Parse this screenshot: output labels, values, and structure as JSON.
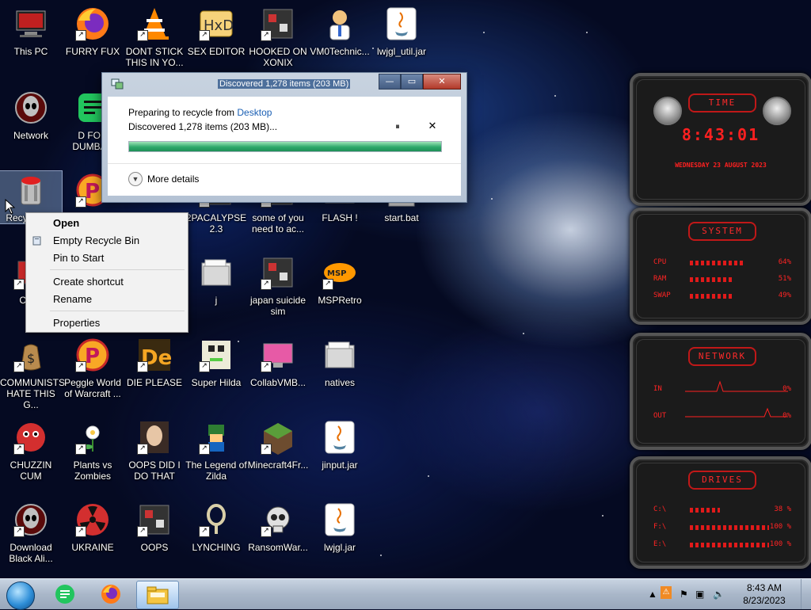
{
  "desktop_icons": [
    {
      "id": "this-pc",
      "label": "This PC",
      "icon": "computer-icon",
      "col": 0,
      "row": 0
    },
    {
      "id": "furry-fux",
      "label": "FURRY FUX",
      "icon": "firefox-icon",
      "col": 1,
      "row": 0
    },
    {
      "id": "dont-stick",
      "label": "DONT STICK THIS IN YO...",
      "icon": "vlc-cone-icon",
      "col": 2,
      "row": 0
    },
    {
      "id": "sex-editor",
      "label": "SEX EDITOR",
      "icon": "hxd-editor-icon",
      "col": 3,
      "row": 0
    },
    {
      "id": "hooked-on-xonix",
      "label": "HOOKED ON XONIX",
      "icon": "game-icon",
      "col": 4,
      "row": 0
    },
    {
      "id": "vm0technic",
      "label": "VM0Technic...",
      "icon": "doctor-icon",
      "col": 5,
      "row": 0
    },
    {
      "id": "lwjgl-util",
      "label": "lwjgl_util.jar",
      "icon": "java-jar-icon",
      "col": 6,
      "row": 0
    },
    {
      "id": "network",
      "label": "Network",
      "icon": "alien-network-icon",
      "col": 0,
      "row": 1
    },
    {
      "id": "d-for-dumbass",
      "label": "D FOR DUMBAS",
      "icon": "green-chat-icon",
      "col": 1,
      "row": 1
    },
    {
      "id": "recycle-bin",
      "label": "Recycle Bin",
      "icon": "recycle-bin-icon",
      "col": 0,
      "row": 2
    },
    {
      "id": "peggle-2",
      "label": "",
      "icon": "peggle-icon",
      "col": 1,
      "row": 2
    },
    {
      "id": "2pacalypse",
      "label": "2PACALYPSE 2.3",
      "icon": "game-icon",
      "col": 3,
      "row": 2
    },
    {
      "id": "some-of-you",
      "label": "some of you need to ac...",
      "icon": "game-icon",
      "col": 4,
      "row": 2
    },
    {
      "id": "flash",
      "label": "FLASH !",
      "icon": "folder-icon",
      "col": 5,
      "row": 2
    },
    {
      "id": "start-bat",
      "label": "start.bat",
      "icon": "batch-file-icon",
      "col": 6,
      "row": 2
    },
    {
      "id": "control-panel",
      "label": "Contr",
      "icon": "control-panel-icon",
      "col": 0,
      "row": 3
    },
    {
      "id": "j-folder",
      "label": "j",
      "icon": "folder-icon",
      "col": 3,
      "row": 3
    },
    {
      "id": "japan-suicide-sim",
      "label": "japan suicide sim",
      "icon": "game-icon",
      "col": 4,
      "row": 3
    },
    {
      "id": "msp-retro",
      "label": "MSPRetro",
      "icon": "msp-icon",
      "col": 5,
      "row": 3
    },
    {
      "id": "communists",
      "label": "COMMUNISTS HATE THIS G...",
      "icon": "money-bag-icon",
      "col": 0,
      "row": 4
    },
    {
      "id": "peggle-world",
      "label": "Peggle World of Warcraft ...",
      "icon": "peggle-icon",
      "col": 1,
      "row": 4
    },
    {
      "id": "die-please",
      "label": "DIE PLEASE",
      "icon": "de-icon",
      "col": 2,
      "row": 4
    },
    {
      "id": "super-hilda",
      "label": "Super Hilda",
      "icon": "pixel-game-icon",
      "col": 3,
      "row": 4
    },
    {
      "id": "collabvmb",
      "label": "CollabVMB...",
      "icon": "monitor-icon",
      "col": 4,
      "row": 4
    },
    {
      "id": "natives",
      "label": "natives",
      "icon": "folder-icon",
      "col": 5,
      "row": 4
    },
    {
      "id": "chuzzin-cum",
      "label": "CHUZZIN CUM",
      "icon": "chuzzle-icon",
      "col": 0,
      "row": 5
    },
    {
      "id": "plants-vs-zombies",
      "label": "Plants vs Zombies",
      "icon": "flower-icon",
      "col": 1,
      "row": 5
    },
    {
      "id": "oops-did-i",
      "label": "OOPS DID I DO THAT",
      "icon": "portrait-icon",
      "col": 2,
      "row": 5
    },
    {
      "id": "legend-of-zilda",
      "label": "The Legend of Zilda",
      "icon": "pixel-hero-icon",
      "col": 3,
      "row": 5
    },
    {
      "id": "minecraft4fr",
      "label": "Minecraft4Fr...",
      "icon": "grass-block-icon",
      "col": 4,
      "row": 5
    },
    {
      "id": "jinput-jar",
      "label": "jinput.jar",
      "icon": "java-jar-icon",
      "col": 5,
      "row": 5
    },
    {
      "id": "download-black-ali",
      "label": "Download Black Ali...",
      "icon": "alien-network-icon",
      "col": 0,
      "row": 6
    },
    {
      "id": "ukraine",
      "label": "UKRAINE",
      "icon": "radiation-icon",
      "col": 1,
      "row": 6
    },
    {
      "id": "oops",
      "label": "OOPS",
      "icon": "game-icon",
      "col": 2,
      "row": 6
    },
    {
      "id": "lynching",
      "label": "LYNCHING",
      "icon": "rope-icon",
      "col": 3,
      "row": 6
    },
    {
      "id": "ransomwar",
      "label": "RansomWar...",
      "icon": "skull-icon",
      "col": 4,
      "row": 6
    },
    {
      "id": "lwjgl-jar",
      "label": "lwjgl.jar",
      "icon": "java-jar-icon",
      "col": 5,
      "row": 6
    }
  ],
  "progress_dialog": {
    "title": "Discovered 1,278 items (203 MB)",
    "line1_prefix": "Preparing to recycle from ",
    "line1_link": "Desktop",
    "line2": "Discovered 1,278 items (203 MB)...",
    "pause_glyph": "⏸",
    "close_glyph": "✕",
    "progress": 1.0,
    "more_details": "More details",
    "window_buttons": {
      "min": "—",
      "max": "▭",
      "close": "✕"
    }
  },
  "context_menu": {
    "items": [
      {
        "label": "Open",
        "bold": true
      },
      {
        "label": "Empty Recycle Bin",
        "icon": "recycle-bin-icon"
      },
      {
        "label": "Pin to Start"
      },
      {
        "separator": true
      },
      {
        "label": "Create shortcut"
      },
      {
        "label": "Rename"
      },
      {
        "separator": true
      },
      {
        "label": "Properties"
      }
    ]
  },
  "gadget": {
    "time_title": "TIME",
    "time": "8:43:01",
    "date": "WEDNESDAY 23 AUGUST 2023",
    "system_title": "SYSTEM",
    "system": [
      {
        "label": "CPU",
        "value": "64%",
        "level": 0.64
      },
      {
        "label": "RAM",
        "value": "51%",
        "level": 0.51
      },
      {
        "label": "SWAP",
        "value": "49%",
        "level": 0.49
      }
    ],
    "network_title": "NETWORK",
    "network": [
      {
        "label": "IN",
        "value": "0%"
      },
      {
        "label": "OUT",
        "value": "0%"
      }
    ],
    "drives_title": "DRIVES",
    "drives": [
      {
        "label": "C:\\",
        "value": "38 %",
        "level": 0.38
      },
      {
        "label": "F:\\",
        "value": "100 %",
        "level": 1.0
      },
      {
        "label": "E:\\",
        "value": "100 %",
        "level": 1.0
      }
    ],
    "accent": "#ff2020"
  },
  "taskbar": {
    "apps": [
      "green-chat-icon",
      "firefox-icon",
      "file-explorer-icon"
    ],
    "time": "8:43 AM",
    "date": "8/23/2023"
  }
}
